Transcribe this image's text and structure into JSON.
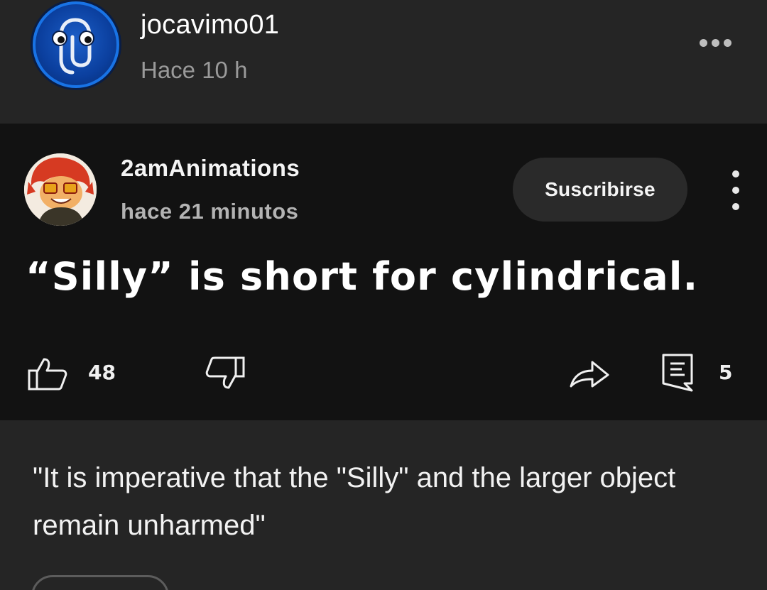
{
  "post": {
    "username": "jocavimo01",
    "timestamp": "Hace 10 h",
    "more_icon": "more-horizontal-icon"
  },
  "embed": {
    "channel": "2amAnimations",
    "time": "hace 21 minutos",
    "subscribe_label": "Suscribirse",
    "text": "“Silly” is short for cylindrical.",
    "likes": "48",
    "comments": "5",
    "icons": {
      "like": "thumbs-up-icon",
      "dislike": "thumbs-down-icon",
      "share": "share-icon",
      "comment": "comment-icon",
      "menu": "more-vertical-icon"
    }
  },
  "caption": "\"It is imperative that the \"Silly\" and the larger object remain unharmed\""
}
